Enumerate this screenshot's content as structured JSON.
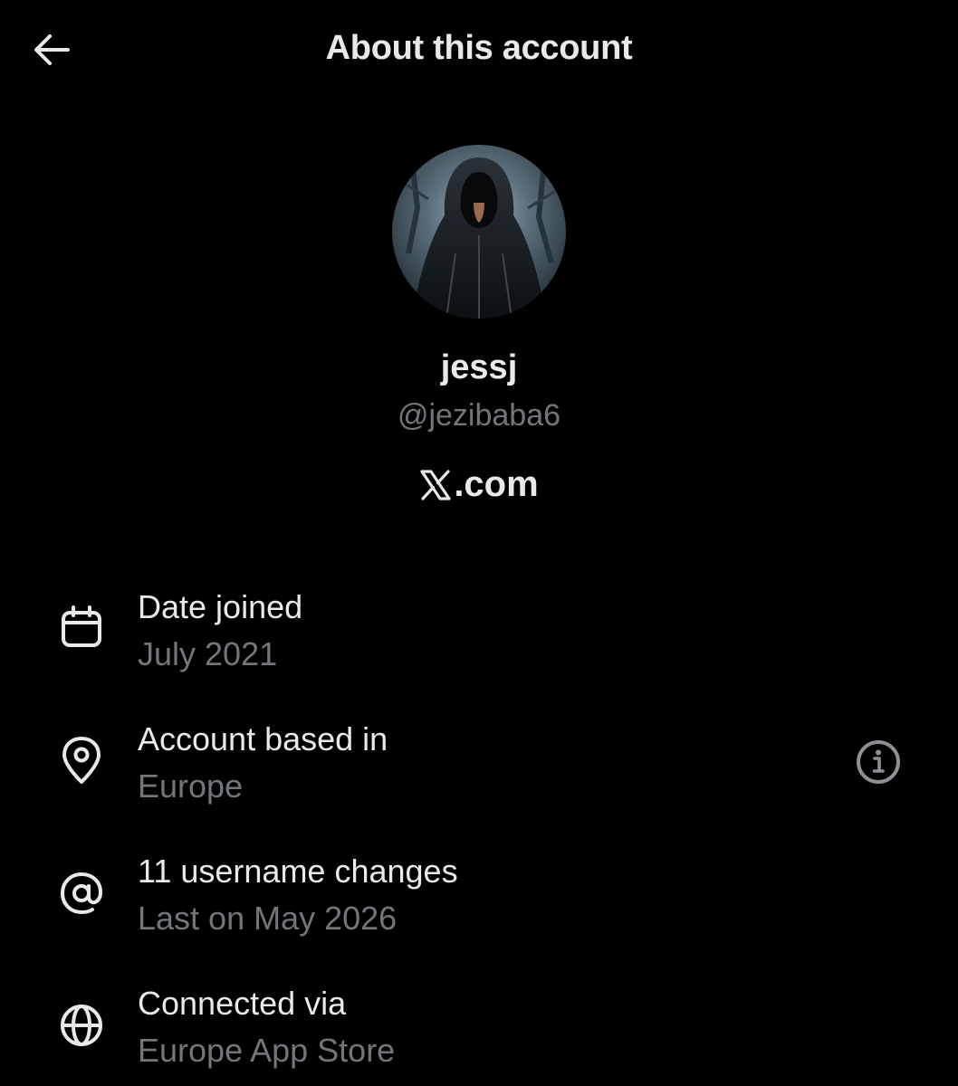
{
  "header": {
    "title": "About this account",
    "back_icon": "arrow-left-icon"
  },
  "profile": {
    "display_name": "jessj",
    "handle": "@jezibaba6",
    "site_text": ".com",
    "site_logo_text": "X"
  },
  "details": [
    {
      "icon": "calendar-icon",
      "label": "Date joined",
      "value": "July 2021"
    },
    {
      "icon": "location-pin-icon",
      "label": "Account based in",
      "value": "Europe",
      "info_icon": "info-icon"
    },
    {
      "icon": "at-sign-icon",
      "label": "11 username changes",
      "value": "Last on May 2026"
    },
    {
      "icon": "globe-icon",
      "label": "Connected via",
      "value": "Europe App Store"
    }
  ],
  "colors": {
    "background": "#000000",
    "primary_text": "#e7e9ea",
    "secondary_text": "#71767b",
    "icon": "#e7e9ea",
    "info_icon": "#71767b"
  }
}
